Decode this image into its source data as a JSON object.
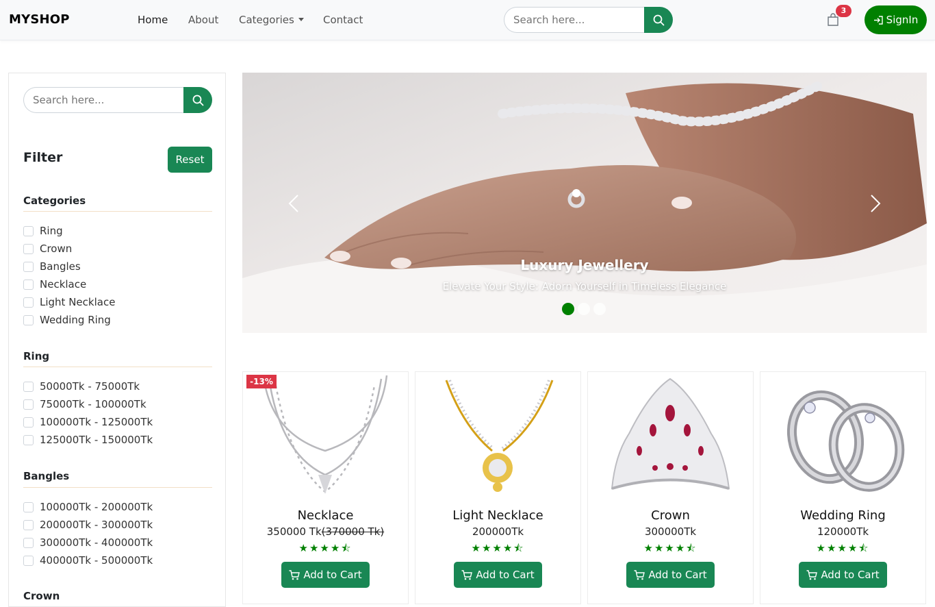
{
  "nav": {
    "brand": "MYSHOP",
    "links": [
      "Home",
      "About",
      "Categories",
      "Contact"
    ],
    "search_placeholder": "Search here...",
    "cart_count": "3",
    "signin_label": "SignIn"
  },
  "sidebar": {
    "search_placeholder": "Search here...",
    "filter_title": "Filter",
    "reset_label": "Reset",
    "sections": [
      {
        "title": "Categories",
        "items": [
          "Ring",
          "Crown",
          "Bangles",
          "Necklace",
          "Light Necklace",
          "Wedding Ring"
        ]
      },
      {
        "title": "Ring",
        "items": [
          "50000Tk - 75000Tk",
          "75000Tk - 100000Tk",
          "100000Tk - 125000Tk",
          "125000Tk - 150000Tk"
        ]
      },
      {
        "title": "Bangles",
        "items": [
          "100000Tk - 200000Tk",
          "200000Tk - 300000Tk",
          "300000Tk - 400000Tk",
          "400000Tk - 500000Tk"
        ]
      },
      {
        "title": "Crown",
        "items": []
      }
    ]
  },
  "carousel": {
    "title": "Luxury Jewellery",
    "subtitle": "Elevate Your Style: Adorn Yourself in Timeless Elegance",
    "active_slide": 1,
    "slide_count": 3
  },
  "products": [
    {
      "name": "Necklace",
      "price": "350000 Tk",
      "old_price": "(370000 Tk)",
      "discount": "-13%",
      "rating": 4.5,
      "button": "Add to Cart"
    },
    {
      "name": "Light Necklace",
      "price": "200000Tk",
      "rating": 4.5,
      "button": "Add to Cart"
    },
    {
      "name": "Crown",
      "price": "300000Tk",
      "rating": 4.5,
      "button": "Add to Cart"
    },
    {
      "name": "Wedding Ring",
      "price": "120000Tk",
      "rating": 4.5,
      "button": "Add to Cart"
    }
  ],
  "colors": {
    "accent": "#198754",
    "brand_green": "#008000",
    "badge_red": "#dc3545"
  }
}
